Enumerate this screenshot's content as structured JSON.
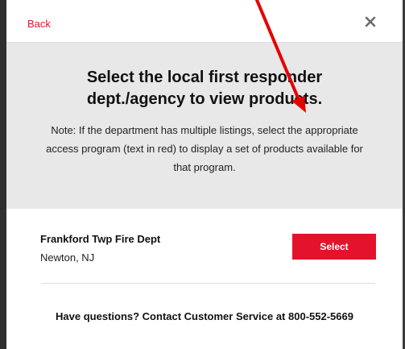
{
  "header": {
    "back_label": "Back",
    "close_icon": "close-icon"
  },
  "info": {
    "title": "Select the local first responder dept./agency to view products.",
    "note": "Note: If the department has multiple listings, select the appropriate access program (text in red) to display a set of products available for that program."
  },
  "listing": {
    "name": "Frankford Twp Fire Dept",
    "location": "Newton, NJ",
    "select_label": "Select"
  },
  "footer": {
    "help_text": "Have questions? Contact Customer Service at 800-552-5669"
  },
  "colors": {
    "accent": "#e3132b",
    "panel_background": "#e8e8e8",
    "annotation_arrow": "#e60000"
  }
}
